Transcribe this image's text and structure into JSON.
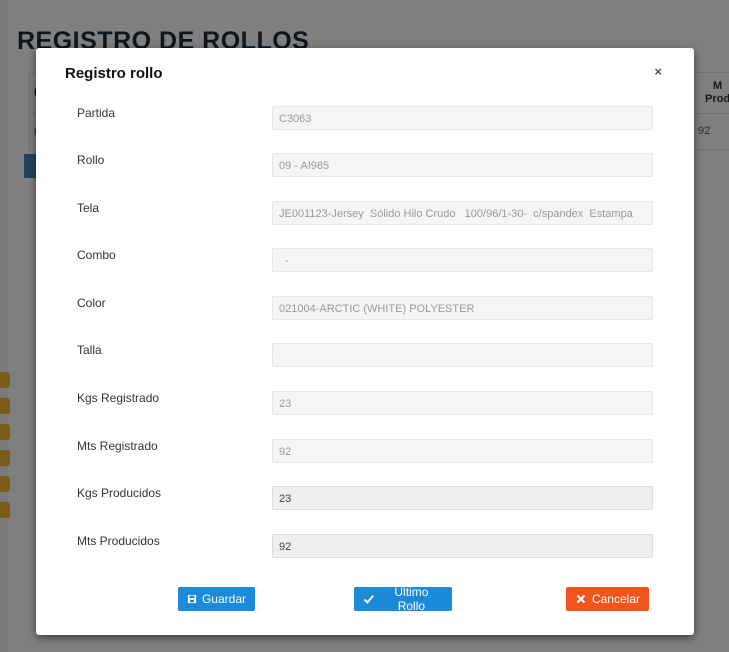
{
  "background": {
    "title": "REGISTRO DE ROLLOS",
    "table": {
      "visible_header": "M\nProd",
      "visible_value": "92",
      "row_prefix": "("
    }
  },
  "modal": {
    "title": "Registro rollo",
    "close_symbol": "×",
    "fields": [
      {
        "label": "Partida",
        "value": "C3063"
      },
      {
        "label": "Rollo",
        "value": "09 - AI985"
      },
      {
        "label": "Tela",
        "value": "JE001123-Jersey  Sólido Hilo Crudo   100/96/1-30-  c/spandex  Estampa"
      },
      {
        "label": "Combo",
        "value": "  -"
      },
      {
        "label": "Color",
        "value": "021004-ARCTIC (WHITE) POLYESTER"
      },
      {
        "label": "Talla",
        "value": ""
      },
      {
        "label": "Kgs Registrado",
        "value": "23"
      },
      {
        "label": "Mts Registrado",
        "value": "92"
      },
      {
        "label": "Kgs Producidos",
        "value": "23"
      },
      {
        "label": "Mts Producidos",
        "value": "92"
      }
    ],
    "buttons": {
      "save": "Guardar",
      "last": "Último Rollo",
      "cancel": "Cancelar"
    }
  },
  "colors": {
    "primary": "#1a8ad9",
    "danger": "#f2541b",
    "overlay": "rgba(0,0,0,0.5)"
  }
}
